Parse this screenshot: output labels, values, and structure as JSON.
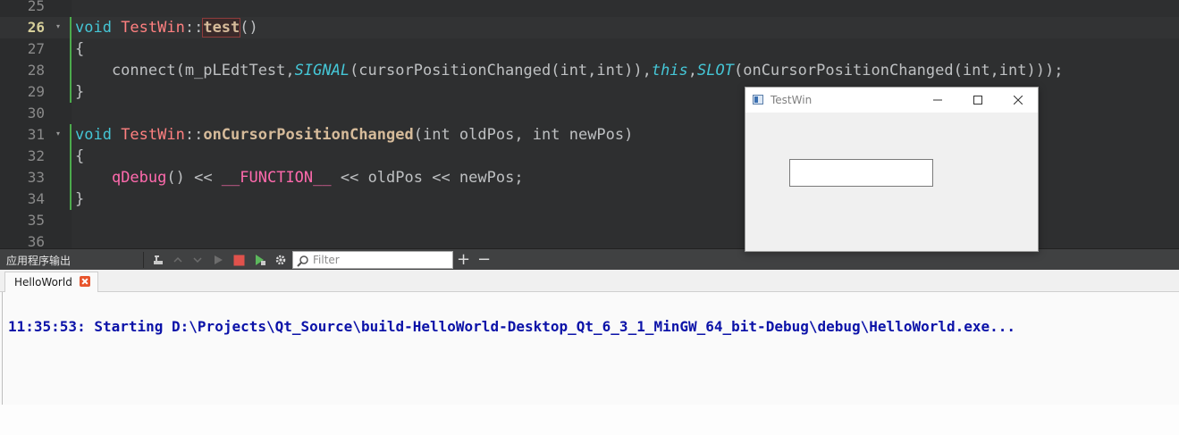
{
  "editor": {
    "lines": [
      {
        "num": "25"
      },
      {
        "num": "26"
      },
      {
        "num": "27"
      },
      {
        "num": "28"
      },
      {
        "num": "29"
      },
      {
        "num": "30"
      },
      {
        "num": "31"
      },
      {
        "num": "32"
      },
      {
        "num": "33"
      },
      {
        "num": "34"
      },
      {
        "num": "35"
      },
      {
        "num": "36"
      }
    ],
    "code": {
      "l26": {
        "void": "void ",
        "cls": "TestWin",
        "sep": "::",
        "fn": "test",
        "rest": "()"
      },
      "l27": "{",
      "l28": {
        "a": "    connect(m_pLEdtTest,",
        "signal": "SIGNAL",
        "b": "(cursorPositionChanged(int,int)),",
        "this": "this",
        "c": ",",
        "slot": "SLOT",
        "d": "(onCursorPositionChanged(int,int)));"
      },
      "l29": "}",
      "l31": {
        "void": "void ",
        "cls": "TestWin",
        "sep": "::",
        "fn": "onCursorPositionChanged",
        "rest": "(int oldPos, int newPos)"
      },
      "l32": "{",
      "l33": {
        "indent": "    ",
        "qdebug": "qDebug",
        "a": "() << ",
        "func": "__FUNCTION__",
        "b": " << oldPos << newPos;"
      },
      "l34": "}"
    }
  },
  "output_pane": {
    "title": "应用程序输出",
    "filter_placeholder": "Filter",
    "plus": "+",
    "minus": "−",
    "tab_label": "HelloWorld",
    "output_line": "11:35:53: Starting D:\\Projects\\Qt_Source\\build-HelloWorld-Desktop_Qt_6_3_1_MinGW_64_bit-Debug\\debug\\HelloWorld.exe..."
  },
  "testwin": {
    "title": "TestWin",
    "minimize": "—",
    "maximize": "☐",
    "close": "✕",
    "edit_value": ""
  }
}
